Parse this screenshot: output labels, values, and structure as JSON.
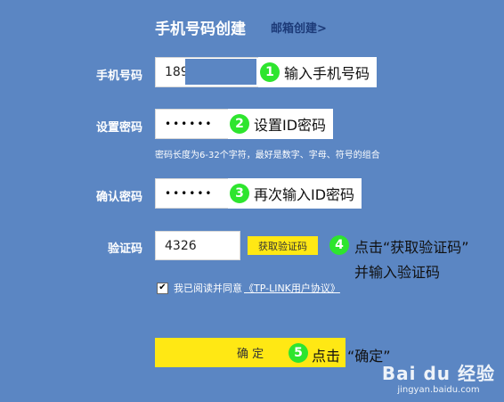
{
  "header": {
    "title": "手机号码创建",
    "email_link": "邮箱创建>"
  },
  "fields": {
    "phone": {
      "label": "手机号码",
      "value": "189"
    },
    "password": {
      "label": "设置密码",
      "value": "••••••"
    },
    "password_hint": "密码长度为6-32个字符，最好是数字、字母、符号的组合",
    "confirm": {
      "label": "确认密码",
      "value": "••••••"
    },
    "captcha": {
      "label": "验证码",
      "value": "4326",
      "button": "获取验证码"
    }
  },
  "agreement": {
    "checked_mark": "✔",
    "text": "我已阅读并同意",
    "link": "《TP-LINK用户协议》"
  },
  "submit": {
    "label": "确 定"
  },
  "annotations": [
    {
      "num": "1",
      "text": "输入手机号码"
    },
    {
      "num": "2",
      "text": "设置ID密码"
    },
    {
      "num": "3",
      "text": "再次输入ID密码"
    },
    {
      "num": "4",
      "text_line1": "点击“获取验证码”",
      "text_line2": "并输入验证码"
    },
    {
      "num": "5",
      "text": "点击",
      "after": "“确定”"
    }
  ],
  "watermark": {
    "logo": "Bai du 经验",
    "sub": "jingyan.baidu.com"
  },
  "colors": {
    "background": "#5b86c3",
    "accent_yellow": "#ffe814",
    "badge_green": "#2ee52e"
  }
}
